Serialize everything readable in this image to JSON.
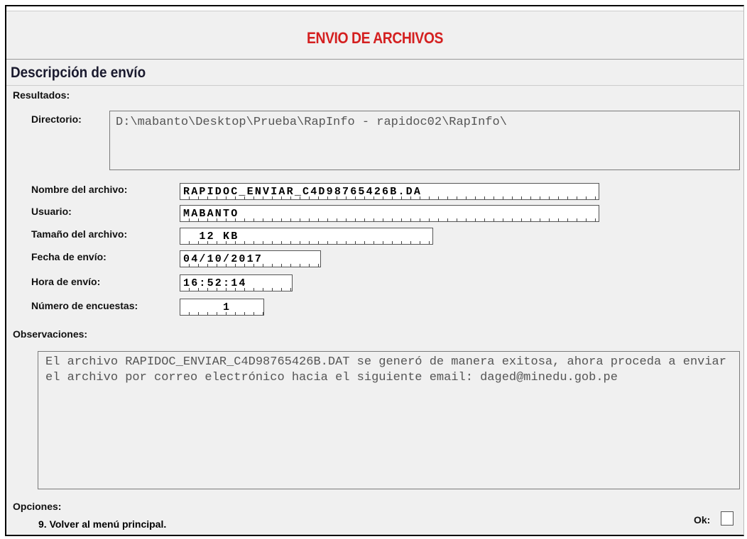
{
  "header": {
    "title": "ENVIO DE ARCHIVOS"
  },
  "section": {
    "title": "Descripción de envío"
  },
  "results": {
    "label": "Resultados:",
    "directory_label": "Directorio:",
    "directory_value": "D:\\mabanto\\Desktop\\Prueba\\RapInfo - rapidoc02\\RapInfo\\",
    "file_name_label": "Nombre del archivo:",
    "file_name_value": "RAPIDOC_ENVIAR_C4D98765426B.DA",
    "user_label": "Usuario:",
    "user_value": "MABANTO",
    "size_label": "Tamaño del archivo:",
    "size_value": "  12 KB",
    "date_label": "Fecha de envío:",
    "date_value": "04/10/2017",
    "time_label": "Hora de envío:",
    "time_value": "16:52:14",
    "surveys_label": "Número de encuestas:",
    "surveys_value": "     1"
  },
  "observations": {
    "label": "Observaciones:",
    "text": "El archivo RAPIDOC_ENVIAR_C4D98765426B.DAT se generó de manera exitosa, ahora proceda a enviar el archivo por correo electrónico hacia el siguiente email: daged@minedu.gob.pe"
  },
  "options": {
    "label": "Opciones:",
    "item": "9. Volver al menú principal.",
    "ok_label": "Ok:"
  }
}
